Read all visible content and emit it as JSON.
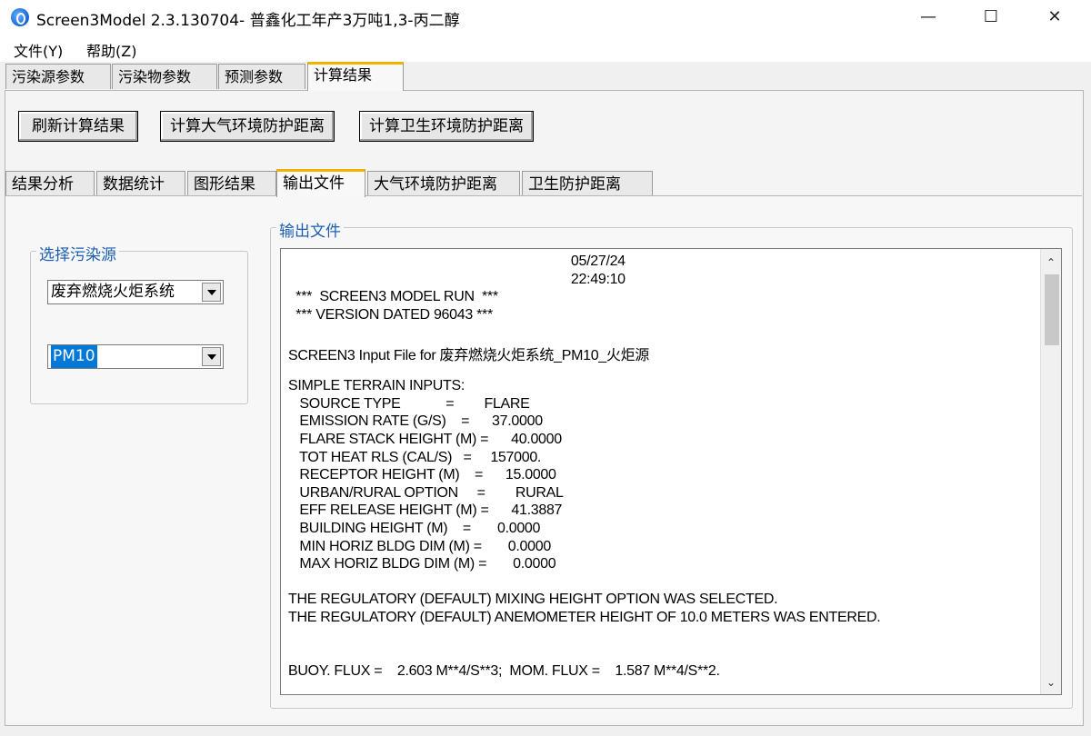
{
  "window": {
    "title": "Screen3Model 2.3.130704- 普鑫化工年产3万吨1,3-丙二醇",
    "minimize": "—",
    "maximize": "☐",
    "close": "✕"
  },
  "menu": [
    "文件(Y)",
    "帮助(Z)"
  ],
  "top_tabs": [
    "污染源参数",
    "污染物参数",
    "预测参数",
    "计算结果"
  ],
  "buttons": {
    "refresh": "刷新计算结果",
    "atmos": "计算大气环境防护距离",
    "health": "计算卫生环境防护距离"
  },
  "sub_tabs": [
    "结果分析",
    "数据统计",
    "图形结果",
    "输出文件",
    "大气环境防护距离",
    "卫生防护距离"
  ],
  "source_group": {
    "label": "选择污染源",
    "source_value": "废弃燃烧火炬系统",
    "pollutant_value": "PM10"
  },
  "output": {
    "label": "输出文件",
    "lines": [
      "                                                                           05/27/24",
      "                                                                           22:49:10",
      "  ***  SCREEN3 MODEL RUN  ***",
      "  *** VERSION DATED 96043 ***",
      "",
      "SCREEN3 Input File for 废弃燃烧火炬系统_PM10_火炬源",
      "",
      "SIMPLE TERRAIN INPUTS:",
      "   SOURCE TYPE            =        FLARE",
      "   EMISSION RATE (G/S)    =      37.0000",
      "   FLARE STACK HEIGHT (M) =      40.0000",
      "   TOT HEAT RLS (CAL/S)   =     157000.",
      "   RECEPTOR HEIGHT (M)    =      15.0000",
      "   URBAN/RURAL OPTION     =        RURAL",
      "   EFF RELEASE HEIGHT (M) =      41.3887",
      "   BUILDING HEIGHT (M)    =       0.0000",
      "   MIN HORIZ BLDG DIM (M) =       0.0000",
      "   MAX HORIZ BLDG DIM (M) =       0.0000",
      "",
      "THE REGULATORY (DEFAULT) MIXING HEIGHT OPTION WAS SELECTED.",
      "THE REGULATORY (DEFAULT) ANEMOMETER HEIGHT OF 10.0 METERS WAS ENTERED.",
      "",
      "",
      "BUOY. FLUX =    2.603 M**4/S**3;  MOM. FLUX =    1.587 M**4/S**2."
    ]
  }
}
